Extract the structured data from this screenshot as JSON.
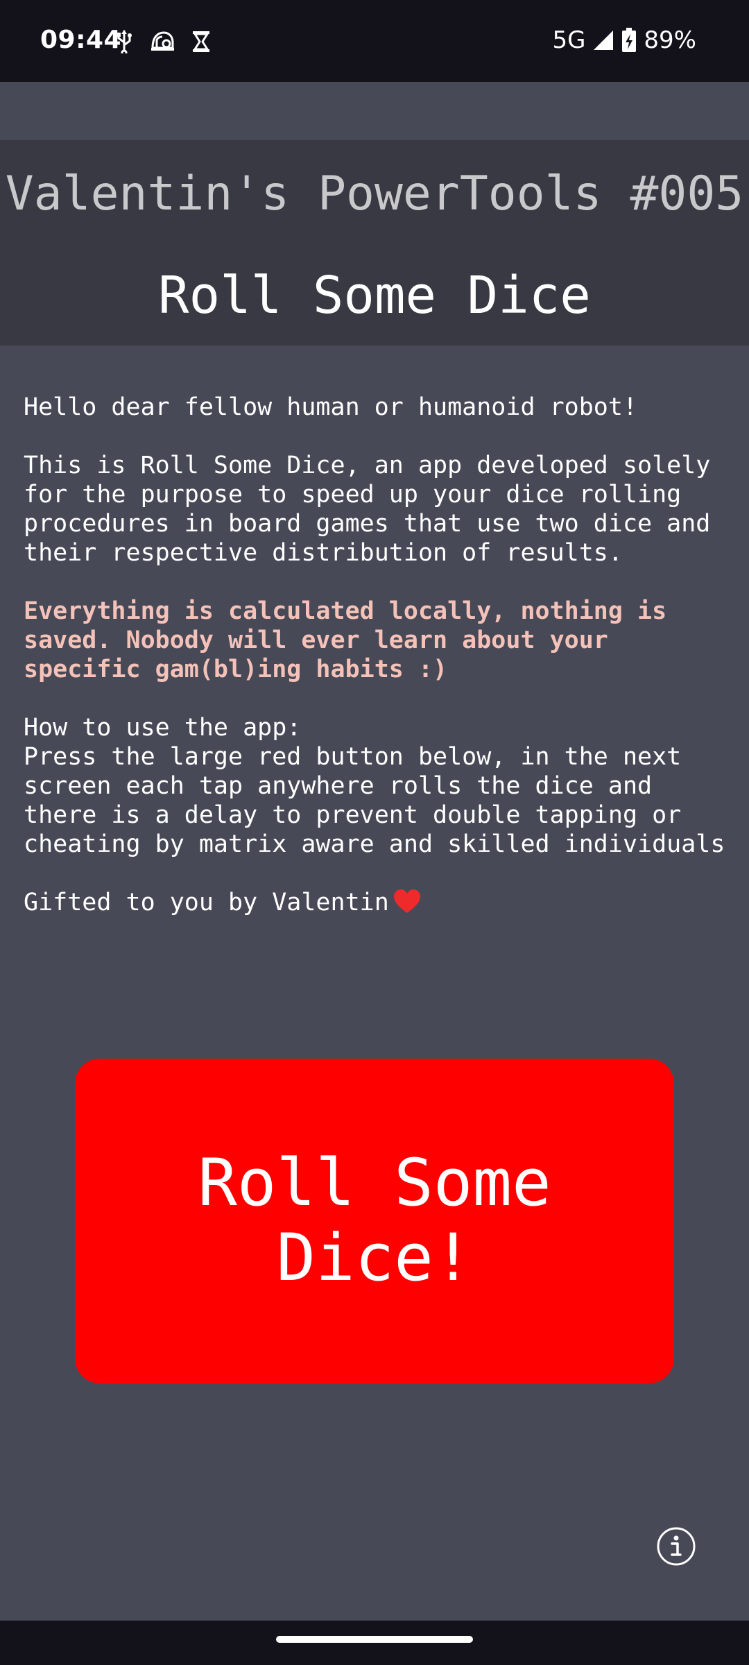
{
  "status_bar": {
    "time": "09:44",
    "network": "5G",
    "battery": "89%",
    "left_icons": [
      "usb-icon",
      "helmet-icon",
      "hourglass-icon"
    ],
    "right_icons": [
      "signal-icon",
      "battery-charging-icon"
    ]
  },
  "header": {
    "subtitle": "Valentin's PowerTools #005",
    "title": "Roll Some Dice"
  },
  "content": {
    "greeting": "Hello dear fellow human or humanoid robot!",
    "description": "This is Roll Some Dice, an app developed solely for the purpose to speed up your dice rolling procedures in board games that use two dice and their respective distribution of results.",
    "privacy_note": "Everything is calculated locally, nothing is saved. Nobody will ever learn about your specific gam(bl)ing habits :)",
    "howto_title": "How to use the app:",
    "howto_text": "Press the large red button below, in the next screen each tap anywhere rolls the dice and there is a delay to prevent double tapping or cheating by matrix aware and skilled individuals",
    "gift_text": "Gifted to you by Valentin"
  },
  "roll_button": {
    "label": "Roll Some Dice!"
  },
  "icons": {
    "heart": "heart-icon",
    "info": "info-icon"
  },
  "colors": {
    "background": "#474956",
    "header_background": "#393944",
    "button": "#ff0000",
    "privacy_text": "#f4c2b8",
    "heart": "#ee2a2a"
  }
}
